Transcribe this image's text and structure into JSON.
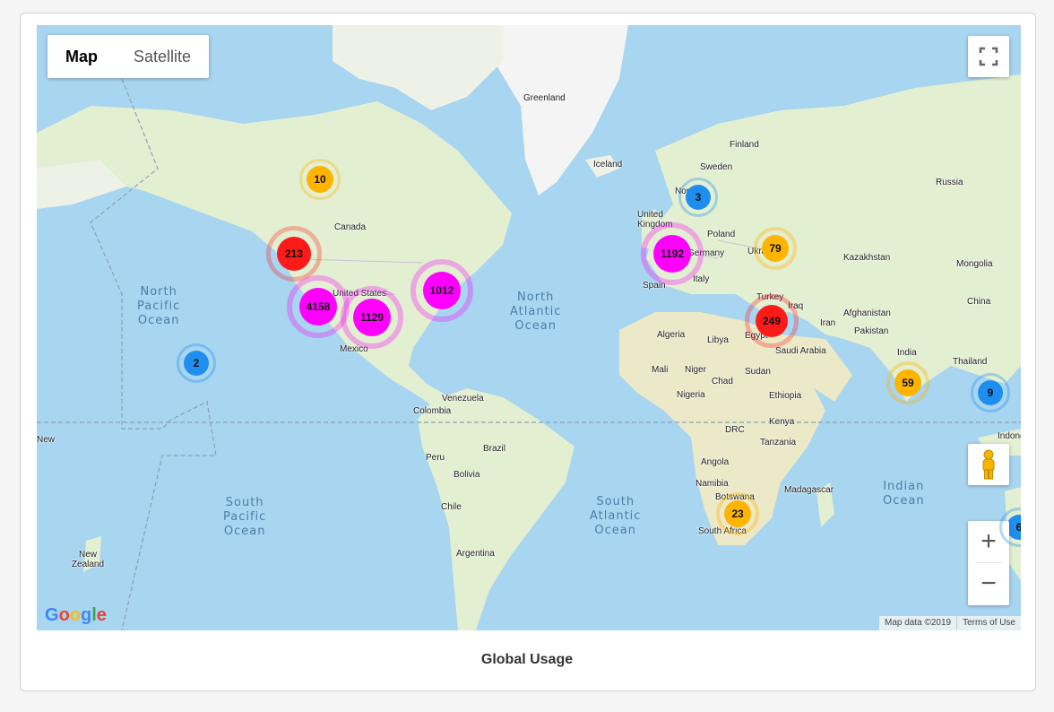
{
  "map_type": {
    "map_label": "Map",
    "satellite_label": "Satellite",
    "selected": "Map"
  },
  "caption": "Global Usage",
  "attribution": {
    "map_data": "Map data ©2019",
    "terms": "Terms of Use"
  },
  "logo": "Google",
  "zoom": {
    "in": "+",
    "out": "−"
  },
  "icons": {
    "fullscreen": "fullscreen-icon",
    "pegman": "pegman-icon"
  },
  "colors": {
    "water": "#a8d5f0",
    "land": "#e3efd1",
    "ice": "#f4f4f4",
    "cluster_blue": "#1f8ef1",
    "cluster_yellow": "#ffb400",
    "cluster_red": "#ff1a1a",
    "cluster_magenta": "#ff00ff"
  },
  "oceans": [
    {
      "id": "north-pacific",
      "text": "North\nPacific\nOcean"
    },
    {
      "id": "north-atlantic",
      "text": "North\nAtlantic\nOcean"
    },
    {
      "id": "south-pacific",
      "text": "South\nPacific\nOcean"
    },
    {
      "id": "south-atlantic",
      "text": "South\nAtlantic\nOcean"
    },
    {
      "id": "indian",
      "text": "Indian\nOcean"
    }
  ],
  "places": [
    "Greenland",
    "Iceland",
    "Finland",
    "Sweden",
    "Norway",
    "Russia",
    "Canada",
    "United States",
    "Mexico",
    "United Kingdom",
    "Poland",
    "Germany",
    "Ukraine",
    "Kazakhstan",
    "Mongolia",
    "China",
    "Spain",
    "Italy",
    "Turkey",
    "Iraq",
    "Iran",
    "Afghanistan",
    "Pakistan",
    "India",
    "Thailand",
    "Algeria",
    "Libya",
    "Egypt",
    "Saudi Arabia",
    "Mali",
    "Niger",
    "Chad",
    "Sudan",
    "Nigeria",
    "Ethiopia",
    "Kenya",
    "DRC",
    "Tanzania",
    "Angola",
    "Namibia",
    "Botswana",
    "South Africa",
    "Madagascar",
    "Venezuela",
    "Colombia",
    "Brazil",
    "Peru",
    "Bolivia",
    "Chile",
    "Argentina",
    "New Zealand",
    "Indonesia",
    "New"
  ],
  "clusters": [
    {
      "id": "canada-north",
      "count": "10",
      "color": "yellow"
    },
    {
      "id": "us-west",
      "count": "213",
      "color": "red"
    },
    {
      "id": "us-southwest",
      "count": "4158",
      "color": "magenta"
    },
    {
      "id": "us-central",
      "count": "1129",
      "color": "magenta"
    },
    {
      "id": "us-east",
      "count": "1012",
      "color": "magenta"
    },
    {
      "id": "hawaii",
      "count": "2",
      "color": "blue"
    },
    {
      "id": "norway",
      "count": "3",
      "color": "blue"
    },
    {
      "id": "western-europe",
      "count": "1192",
      "color": "magenta"
    },
    {
      "id": "ukraine",
      "count": "79",
      "color": "yellow"
    },
    {
      "id": "middle-east",
      "count": "249",
      "color": "red"
    },
    {
      "id": "india",
      "count": "59",
      "color": "yellow"
    },
    {
      "id": "southeast-asia",
      "count": "9",
      "color": "blue"
    },
    {
      "id": "south-africa",
      "count": "23",
      "color": "yellow"
    },
    {
      "id": "australia-edge",
      "count": "6",
      "color": "blue"
    }
  ]
}
